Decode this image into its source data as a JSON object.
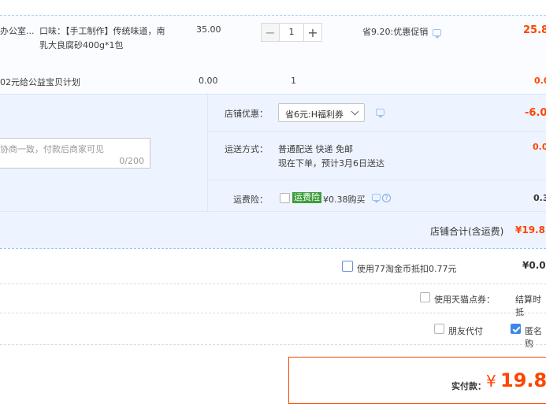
{
  "item": {
    "title_part": "办公室...",
    "flavor_line1": "口味：【手工制作】传统味道，南",
    "flavor_line2": "乳大良腐砂400g*1包",
    "unit_price": "35.00",
    "quantity": "1",
    "promo": "省9.20:优惠促销",
    "subtotal": "25.8"
  },
  "charity": {
    "label": "02元给公益宝贝计划",
    "price": "0.00",
    "quantity": "1",
    "subtotal": "0.0"
  },
  "store_options": {
    "discount_label": "店铺优惠：",
    "discount_selected": "省6元:H福利券",
    "discount_amount": "-6.0",
    "shipping_label": "运送方式：",
    "shipping_method": "普通配送 快递 免邮",
    "shipping_eta": "现在下单，预计3月6日送达",
    "shipping_amount": "0.0",
    "insurance_label": "运费险：",
    "insurance_badge": "运费险",
    "insurance_text": "¥0.38购买",
    "insurance_amount": "0.3",
    "message_placeholder": "协商一致，付款后商家可见",
    "message_count": "0/200",
    "store_total_label": "店铺合计(含运费)",
    "store_total": "¥19.8"
  },
  "extras": {
    "coins_label": "使用77淘金币抵扣0.77元",
    "coins_amount": "¥0.0",
    "tmall_points_label": "使用天猫点券：",
    "tmall_points_right": "结算时抵",
    "friend_pay_label": "朋友代付",
    "anonymous_label": "匿名购"
  },
  "payment": {
    "label": "实付款：",
    "currency": "¥",
    "amount": "19.80"
  },
  "colors": {
    "accent_red": "#ff4400",
    "link_blue": "#3f87e8"
  }
}
